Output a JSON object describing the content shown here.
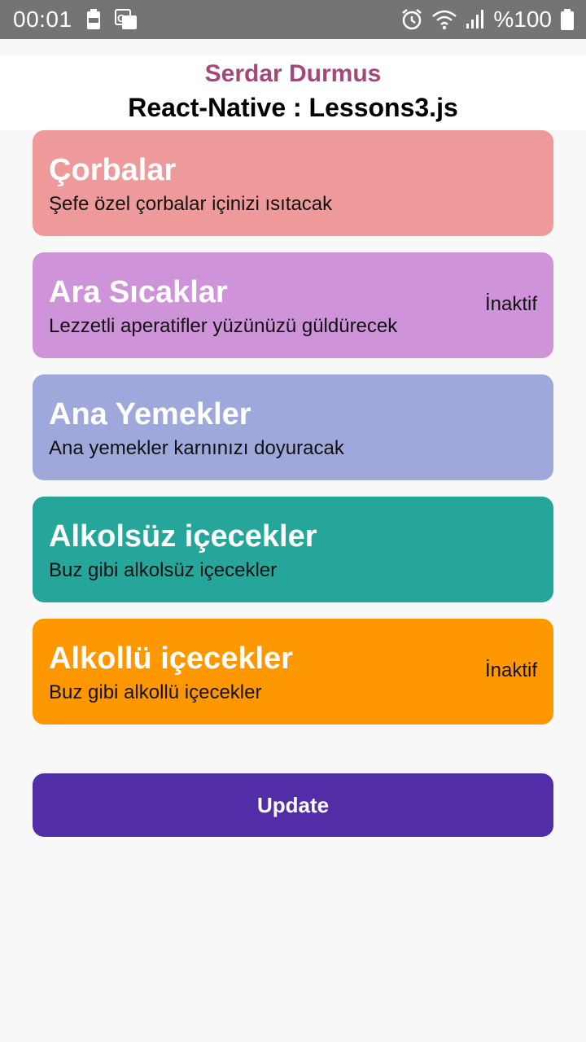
{
  "status_bar": {
    "time": "00:01",
    "battery_text": "%100",
    "icons": [
      "battery-saver-icon",
      "translate-icon",
      "alarm-icon",
      "wifi-icon",
      "signal-icon",
      "battery-icon"
    ]
  },
  "header": {
    "author": "Serdar Durmus",
    "subtitle": "React-Native : Lessons3.js",
    "author_color": "#a4487a"
  },
  "categories": [
    {
      "title": "Çorbalar",
      "description": "Şefe özel çorbalar içinizi ısıtacak",
      "status": "",
      "color": "#ef9a9a"
    },
    {
      "title": "Ara Sıcaklar",
      "description": "Lezzetli aperatifler yüzünüzü güldürecek",
      "status": "İnaktif",
      "color": "#ce93d8"
    },
    {
      "title": "Ana Yemekler",
      "description": "Ana yemekler karnınızı doyuracak",
      "status": "",
      "color": "#9fa8da"
    },
    {
      "title": "Alkolsüz içecekler",
      "description": "Buz gibi alkolsüz içecekler",
      "status": "",
      "color": "#26a69a"
    },
    {
      "title": "Alkollü içecekler",
      "description": "Buz gibi alkollü içecekler",
      "status": "İnaktif",
      "color": "#ff9800"
    }
  ],
  "update_button": {
    "label": "Update",
    "color": "#512da8"
  }
}
